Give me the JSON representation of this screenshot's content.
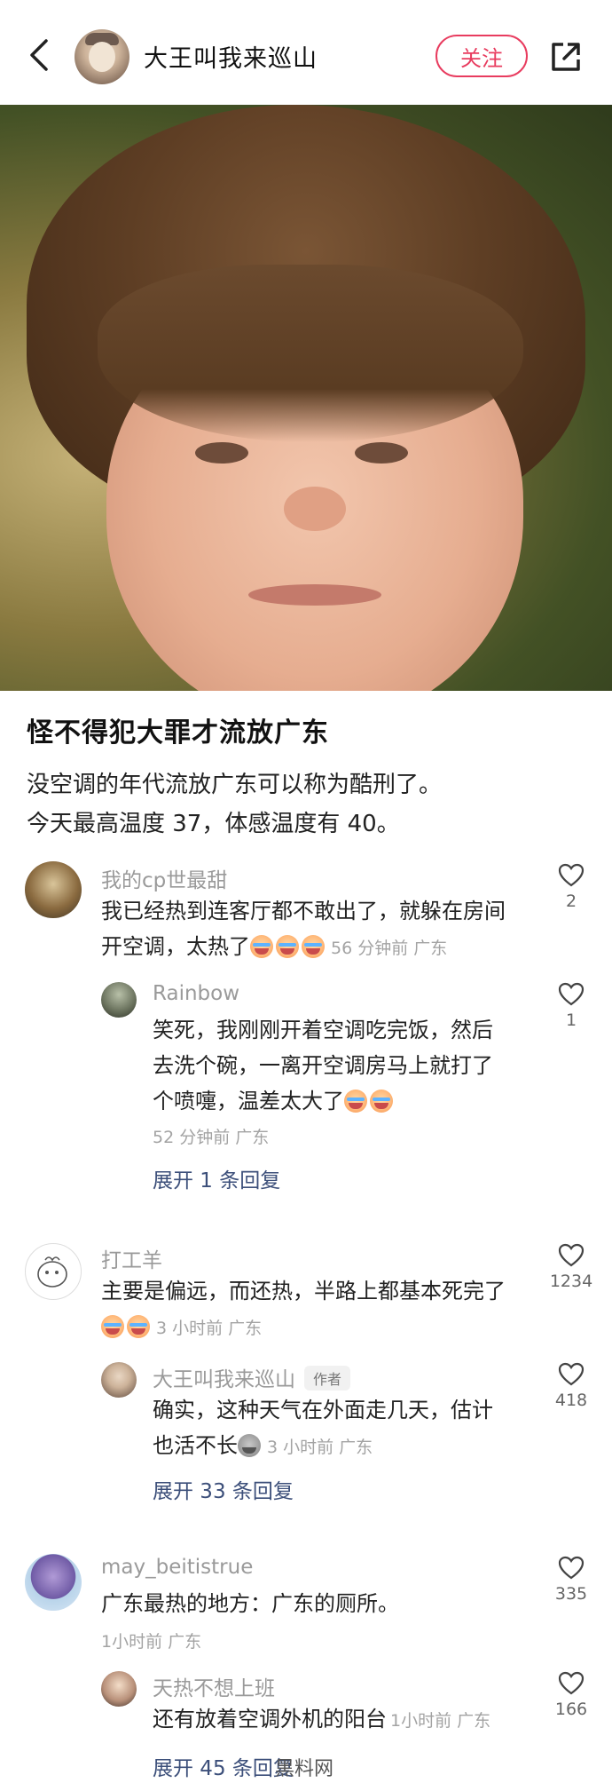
{
  "header": {
    "author_name": "大王叫我来巡山",
    "follow_label": "关注"
  },
  "post": {
    "title": "怪不得犯大罪才流放广东",
    "body_line1": "没空调的年代流放广东可以称为酷刑了。",
    "body_line2": "今天最高温度 37，体感温度有 40。"
  },
  "comments": [
    {
      "name": "我的cp世最甜",
      "text_line1": "我已经热到连客厅都不敢出了，就躲在房间",
      "text_line2": "开空调，太热了",
      "time": "56 分钟前 广东",
      "likes": "2",
      "reply": {
        "name": "Rainbow",
        "text_line1": "笑死，我刚刚开着空调吃完饭，然后",
        "text_line2": "去洗个碗，一离开空调房马上就打了",
        "text_line3": "个喷嚏，温差太大了",
        "time": "52 分钟前 广东",
        "likes": "1"
      },
      "expand_label": "展开 1 条回复"
    },
    {
      "name": "打工羊",
      "text_line1": "主要是偏远，而还热，半路上都基本死完了",
      "time": "3 小时前 广东",
      "likes": "1234",
      "reply": {
        "name": "大王叫我来巡山",
        "author_tag": "作者",
        "text_line1": "确实，这种天气在外面走几天，估计",
        "text_line2": "也活不长",
        "time": "3 小时前 广东",
        "likes": "418"
      },
      "expand_label": "展开 33 条回复"
    },
    {
      "name": "may_beitistrue",
      "text_line1": "广东最热的地方：广东的厕所。",
      "time": "1小时前 广东",
      "likes": "335",
      "reply": {
        "name": "天热不想上班",
        "text_line1": "还有放着空调外机的阳台",
        "time": "1小时前 广东",
        "likes": "166"
      },
      "expand_label": "展开 45 条回复"
    }
  ],
  "watermark": "黑料网",
  "colors": {
    "accent": "#e83c5f",
    "link": "#3c4f7a",
    "muted": "#9a9a9a"
  }
}
